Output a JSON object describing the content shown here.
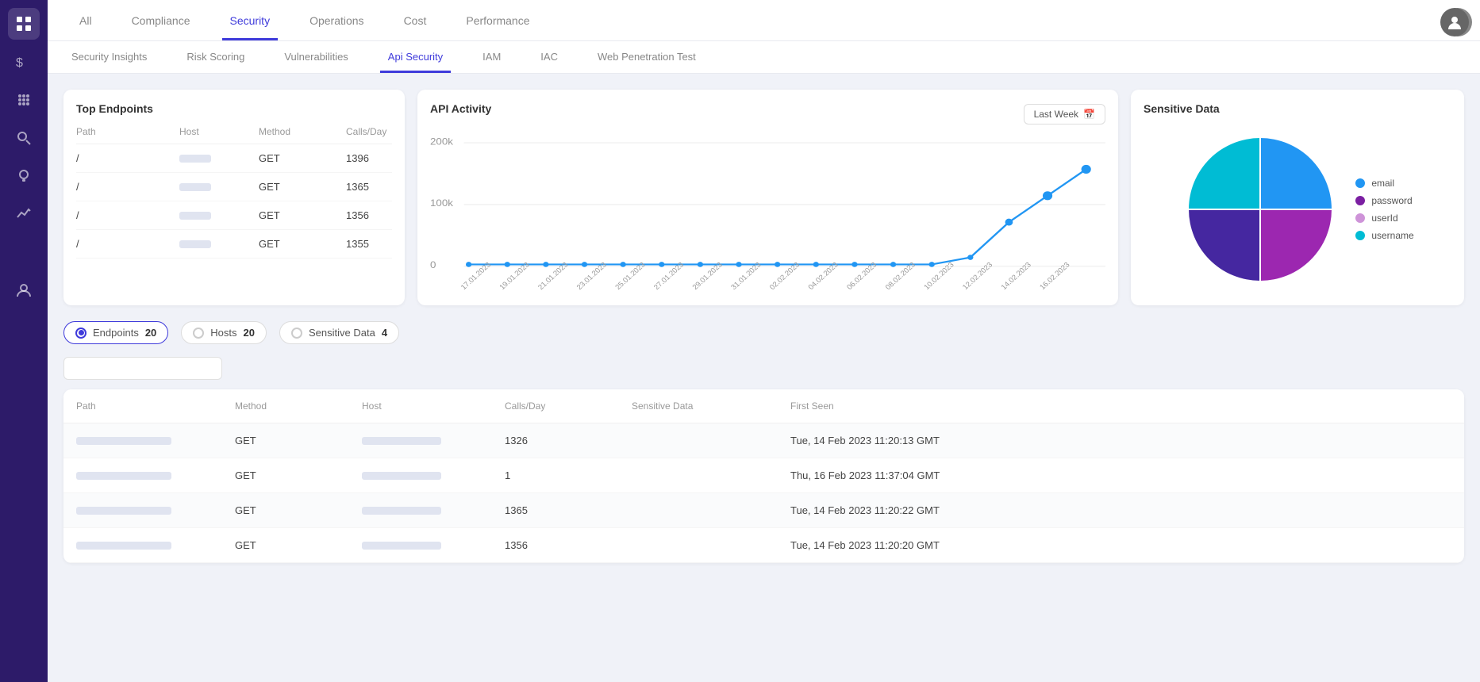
{
  "sidebar": {
    "icons": [
      {
        "name": "dashboard-icon",
        "symbol": "⊞"
      },
      {
        "name": "billing-icon",
        "symbol": "$"
      },
      {
        "name": "grid-icon",
        "symbol": "⋮⋮"
      },
      {
        "name": "search-icon",
        "symbol": "🔍"
      },
      {
        "name": "insights-icon",
        "symbol": "💡"
      },
      {
        "name": "chart-icon",
        "symbol": "∿"
      },
      {
        "name": "user-icon",
        "symbol": "👤"
      }
    ]
  },
  "topTabs": [
    {
      "label": "All",
      "active": false
    },
    {
      "label": "Compliance",
      "active": false
    },
    {
      "label": "Security",
      "active": true
    },
    {
      "label": "Operations",
      "active": false
    },
    {
      "label": "Cost",
      "active": false
    },
    {
      "label": "Performance",
      "active": false
    }
  ],
  "subTabs": [
    {
      "label": "Security Insights",
      "active": false
    },
    {
      "label": "Risk Scoring",
      "active": false
    },
    {
      "label": "Vulnerabilities",
      "active": false
    },
    {
      "label": "Api Security",
      "active": true
    },
    {
      "label": "IAM",
      "active": false
    },
    {
      "label": "IAC",
      "active": false
    },
    {
      "label": "Web Penetration Test",
      "active": false
    }
  ],
  "topEndpoints": {
    "title": "Top Endpoints",
    "columns": [
      "Path",
      "Host",
      "Method",
      "Calls/Day"
    ],
    "rows": [
      {
        "path": "/",
        "method": "GET",
        "calls": "1396"
      },
      {
        "path": "/",
        "method": "GET",
        "calls": "1365"
      },
      {
        "path": "/",
        "method": "GET",
        "calls": "1356"
      },
      {
        "path": "/",
        "method": "GET",
        "calls": "1355"
      }
    ]
  },
  "apiActivity": {
    "title": "API Activity",
    "button": "Last Week",
    "yLabels": [
      "200k",
      "100k",
      "0"
    ],
    "xLabels": [
      "17.01.2023",
      "19.01.2023",
      "21.01.2023",
      "23.01.2023",
      "25.01.2023",
      "27.01.2023",
      "29.01.2023",
      "31.01.2023",
      "02.02.2023",
      "04.02.2023",
      "06.02.2023",
      "08.02.2023",
      "10.02.2023",
      "12.02.2023",
      "14.02.2023",
      "16.02.2023"
    ]
  },
  "sensitiveData": {
    "title": "Sensitive Data",
    "legend": [
      {
        "label": "email",
        "color": "#2196f3"
      },
      {
        "label": "password",
        "color": "#7b1fa2"
      },
      {
        "label": "userId",
        "color": "#ce93d8"
      },
      {
        "label": "username",
        "color": "#00bcd4"
      }
    ]
  },
  "filterOptions": [
    {
      "label": "Endpoints",
      "count": "20",
      "active": true
    },
    {
      "label": "Hosts",
      "count": "20",
      "active": false
    },
    {
      "label": "Sensitive Data",
      "count": "4",
      "active": false
    }
  ],
  "searchPlaceholder": "",
  "tableColumns": [
    "Path",
    "Method",
    "Host",
    "Calls/Day",
    "Sensitive Data",
    "First Seen"
  ],
  "tableRows": [
    {
      "method": "GET",
      "calls": "1326",
      "firstSeen": "Tue, 14 Feb 2023 11:20:13 GMT"
    },
    {
      "method": "GET",
      "calls": "1",
      "firstSeen": "Thu, 16 Feb 2023 11:37:04 GMT"
    },
    {
      "method": "GET",
      "calls": "1365",
      "firstSeen": "Tue, 14 Feb 2023 11:20:22 GMT"
    },
    {
      "method": "GET",
      "calls": "1356",
      "firstSeen": "Tue, 14 Feb 2023 11:20:20 GMT"
    }
  ]
}
